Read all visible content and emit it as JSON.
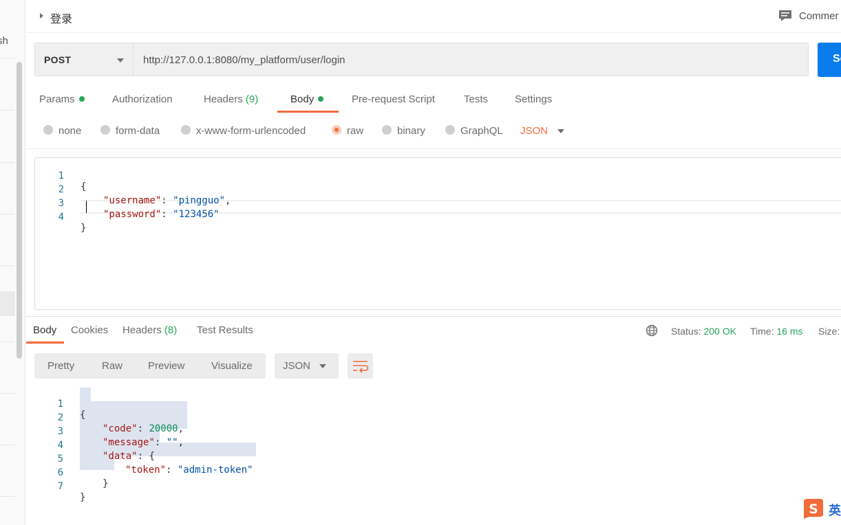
{
  "sidebar": {
    "partial_text": "sh"
  },
  "header": {
    "request_name": "登录",
    "comments_label": "Commer"
  },
  "request": {
    "method": "POST",
    "url": "http://127.0.0.1:8080/my_platform/user/login",
    "send_label": "Se"
  },
  "tabs": [
    {
      "label": "Params",
      "count": "",
      "has_dot": true
    },
    {
      "label": "Authorization",
      "count": "",
      "has_dot": false
    },
    {
      "label": "Headers",
      "count": "(9)",
      "has_dot": false
    },
    {
      "label": "Body",
      "count": "",
      "has_dot": true,
      "active": true
    },
    {
      "label": "Pre-request Script",
      "count": "",
      "has_dot": false
    },
    {
      "label": "Tests",
      "count": "",
      "has_dot": false
    },
    {
      "label": "Settings",
      "count": "",
      "has_dot": false
    }
  ],
  "body_types": [
    {
      "label": "none",
      "selected": false
    },
    {
      "label": "form-data",
      "selected": false
    },
    {
      "label": "x-www-form-urlencoded",
      "selected": false
    },
    {
      "label": "raw",
      "selected": true
    },
    {
      "label": "binary",
      "selected": false
    },
    {
      "label": "GraphQL",
      "selected": false
    }
  ],
  "raw_language": "JSON",
  "request_body": {
    "line_numbers": [
      "1",
      "2",
      "3",
      "4"
    ],
    "lines": [
      {
        "text": "{"
      },
      {
        "key": "\"username\"",
        "value": "\"pingguo\"",
        "trail": ","
      },
      {
        "key": "\"password\"",
        "value": "\"123456\"",
        "trail": ""
      },
      {
        "text": "}"
      }
    ]
  },
  "response": {
    "tabs": [
      {
        "label": "Body",
        "count": "",
        "active": true
      },
      {
        "label": "Cookies",
        "count": ""
      },
      {
        "label": "Headers",
        "count": "(8)"
      },
      {
        "label": "Test Results",
        "count": ""
      }
    ],
    "status_label": "Status:",
    "status_value": "200 OK",
    "time_label": "Time:",
    "time_value": "16 ms",
    "size_label": "Size:",
    "view_modes": [
      "Pretty",
      "Raw",
      "Preview",
      "Visualize"
    ],
    "active_view": "Pretty",
    "format": "JSON",
    "line_numbers": [
      "1",
      "2",
      "3",
      "4",
      "5",
      "6",
      "7"
    ],
    "body": {
      "l1": "{",
      "code_key": "\"code\"",
      "code_value": "20000",
      "message_key": "\"message\"",
      "message_value": "\"\"",
      "data_key": "\"data\"",
      "data_open": "{",
      "token_key": "\"token\"",
      "token_value": "\"admin-token\"",
      "data_close": "}",
      "l7": "}"
    }
  },
  "ime_indicator": {
    "logo": "S",
    "text": "英"
  },
  "colors": {
    "accent": "#f26b3a",
    "send": "#097bed",
    "success": "#26a65b",
    "json_key": "#a31515",
    "json_string": "#0451a5",
    "json_number": "#098658"
  }
}
